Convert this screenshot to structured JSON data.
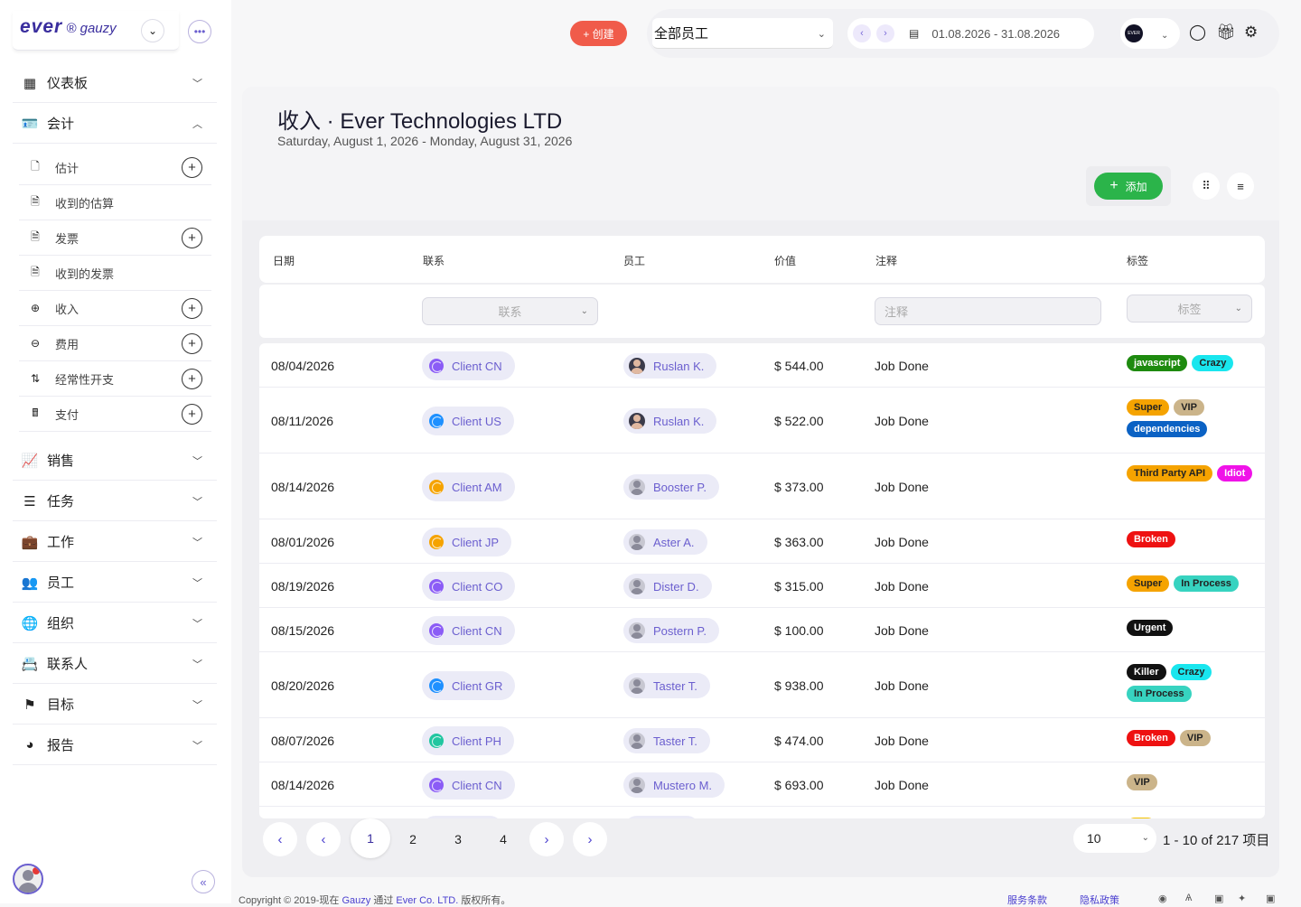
{
  "brand": {
    "logo_main": "ever",
    "logo_sub": "gauzy"
  },
  "sidebar": {
    "items": [
      {
        "name": "dashboard",
        "icon": "grid-icon",
        "glyph": "▦",
        "label": "仪表板",
        "expanded": false
      },
      {
        "name": "accounting",
        "icon": "id-card-icon",
        "glyph": "🪪",
        "label": "会计",
        "expanded": true
      },
      {
        "name": "sales",
        "icon": "line-chart-icon",
        "glyph": "📈",
        "label": "销售",
        "expanded": false
      },
      {
        "name": "tasks",
        "icon": "list-icon",
        "glyph": "☰",
        "label": "任务",
        "expanded": false
      },
      {
        "name": "jobs",
        "icon": "briefcase-icon",
        "glyph": "💼",
        "label": "工作",
        "expanded": false
      },
      {
        "name": "employees",
        "icon": "people-icon",
        "glyph": "👥",
        "label": "员工",
        "expanded": false
      },
      {
        "name": "organization",
        "icon": "globe-icon",
        "glyph": "🌐",
        "label": "组织",
        "expanded": false
      },
      {
        "name": "contacts",
        "icon": "contact-book-icon",
        "glyph": "📇",
        "label": "联系人",
        "expanded": false
      },
      {
        "name": "goals",
        "icon": "flag-icon",
        "glyph": "⚑",
        "label": "目标",
        "expanded": false
      },
      {
        "name": "reports",
        "icon": "pie-chart-icon",
        "glyph": "◕",
        "label": "报告",
        "expanded": false
      }
    ],
    "accounting_sub": [
      {
        "name": "estimates",
        "icon": "file-icon",
        "glyph": "🗋",
        "label": "估计",
        "add": true
      },
      {
        "name": "received-estimates",
        "icon": "file-filled-icon",
        "glyph": "🗎",
        "label": "收到的估算",
        "add": false
      },
      {
        "name": "invoices",
        "icon": "file-text-icon",
        "glyph": "🗎",
        "label": "发票",
        "add": true
      },
      {
        "name": "received-invoices",
        "icon": "file-lock-icon",
        "glyph": "🗎",
        "label": "收到的发票",
        "add": false
      },
      {
        "name": "income",
        "icon": "plus-circle-icon",
        "glyph": "⊕",
        "label": "收入",
        "add": true
      },
      {
        "name": "expenses",
        "icon": "minus-circle-icon",
        "glyph": "⊖",
        "label": "费用",
        "add": true
      },
      {
        "name": "recurring-expenses",
        "icon": "arrows-updown-icon",
        "glyph": "⇅",
        "label": "经常性开支",
        "add": true
      },
      {
        "name": "payments",
        "icon": "cash-register-icon",
        "glyph": "🖩",
        "label": "支付",
        "add": true
      }
    ]
  },
  "topbar": {
    "create_label": "+ 创建",
    "employee_select": "全部员工",
    "date_range": "01.08.2026 - 31.08.2026",
    "org_logo_text": "EVER"
  },
  "page": {
    "title": "收入 · Ever Technologies LTD",
    "subtitle": "Saturday, August 1, 2026 - Monday, August 31, 2026",
    "add_label": "添加"
  },
  "table": {
    "headers": {
      "date": "日期",
      "contact": "联系",
      "employee": "员工",
      "value": "价值",
      "notes": "注释",
      "tags": "标签"
    },
    "filters": {
      "contact": "联系",
      "notes": "注释",
      "tags": "标签"
    },
    "rows": [
      {
        "date": "08/04/2026",
        "contact": "Client CN",
        "contact_color": "#8b5cf6",
        "employee": "Ruslan K.",
        "emp_dark": true,
        "value": "$ 544.00",
        "notes": "Job Done",
        "tags": [
          {
            "t": "javascript",
            "bg": "#1e8a0f",
            "fg": "#fff"
          },
          {
            "t": "Crazy",
            "bg": "#19e6ee",
            "fg": "#222"
          }
        ]
      },
      {
        "date": "08/11/2026",
        "contact": "Client US",
        "contact_color": "#1e90ff",
        "employee": "Ruslan K.",
        "emp_dark": true,
        "value": "$ 522.00",
        "notes": "Job Done",
        "tags": [
          {
            "t": "Super",
            "bg": "#f5a300",
            "fg": "#222"
          },
          {
            "t": "VIP",
            "bg": "#cbb48a",
            "fg": "#222"
          },
          {
            "t": "dependencies",
            "bg": "#0b62c4",
            "fg": "#fff"
          }
        ]
      },
      {
        "date": "08/14/2026",
        "contact": "Client AM",
        "contact_color": "#f5a300",
        "employee": "Booster P.",
        "emp_dark": false,
        "value": "$ 373.00",
        "notes": "Job Done",
        "tags": [
          {
            "t": "Third Party API",
            "bg": "#f5a300",
            "fg": "#222"
          },
          {
            "t": "Idiot",
            "bg": "#f012e8",
            "fg": "#fff"
          }
        ]
      },
      {
        "date": "08/01/2026",
        "contact": "Client JP",
        "contact_color": "#f5a300",
        "employee": "Aster A.",
        "emp_dark": false,
        "value": "$ 363.00",
        "notes": "Job Done",
        "tags": [
          {
            "t": "Broken",
            "bg": "#ee1111",
            "fg": "#fff"
          }
        ]
      },
      {
        "date": "08/19/2026",
        "contact": "Client CO",
        "contact_color": "#8b5cf6",
        "employee": "Dister D.",
        "emp_dark": false,
        "value": "$ 315.00",
        "notes": "Job Done",
        "tags": [
          {
            "t": "Super",
            "bg": "#f5a300",
            "fg": "#222"
          },
          {
            "t": "In Process",
            "bg": "#37d3c0",
            "fg": "#222"
          }
        ]
      },
      {
        "date": "08/15/2026",
        "contact": "Client CN",
        "contact_color": "#8b5cf6",
        "employee": "Postern P.",
        "emp_dark": false,
        "value": "$ 100.00",
        "notes": "Job Done",
        "tags": [
          {
            "t": "Urgent",
            "bg": "#111111",
            "fg": "#fff"
          }
        ]
      },
      {
        "date": "08/20/2026",
        "contact": "Client GR",
        "contact_color": "#1e90ff",
        "employee": "Taster T.",
        "emp_dark": false,
        "value": "$ 938.00",
        "notes": "Job Done",
        "tags": [
          {
            "t": "Killer",
            "bg": "#111111",
            "fg": "#fff"
          },
          {
            "t": "Crazy",
            "bg": "#19e6ee",
            "fg": "#222"
          },
          {
            "t": "In Process",
            "bg": "#37d3c0",
            "fg": "#222"
          }
        ]
      },
      {
        "date": "08/07/2026",
        "contact": "Client PH",
        "contact_color": "#21c6a0",
        "employee": "Taster T.",
        "emp_dark": false,
        "value": "$ 474.00",
        "notes": "Job Done",
        "tags": [
          {
            "t": "Broken",
            "bg": "#ee1111",
            "fg": "#fff"
          },
          {
            "t": "VIP",
            "bg": "#cbb48a",
            "fg": "#222"
          }
        ]
      },
      {
        "date": "08/14/2026",
        "contact": "Client CN",
        "contact_color": "#8b5cf6",
        "employee": "Mustero M.",
        "emp_dark": false,
        "value": "$ 693.00",
        "notes": "Job Done",
        "tags": [
          {
            "t": "VIP",
            "bg": "#cbb48a",
            "fg": "#222"
          }
        ]
      }
    ]
  },
  "pagination": {
    "pages": [
      "1",
      "2",
      "3",
      "4"
    ],
    "current": "1",
    "per_page": "10",
    "summary": "1 - 10 of 217 项目"
  },
  "footer": {
    "copyright_prefix": "Copyright © 2019-现在",
    "brand_link": "Gauzy",
    "via": "通过",
    "company_link": "Ever Co. LTD.",
    "rights": "版权所有。",
    "terms": "服务条款",
    "privacy": "隐私政策"
  }
}
